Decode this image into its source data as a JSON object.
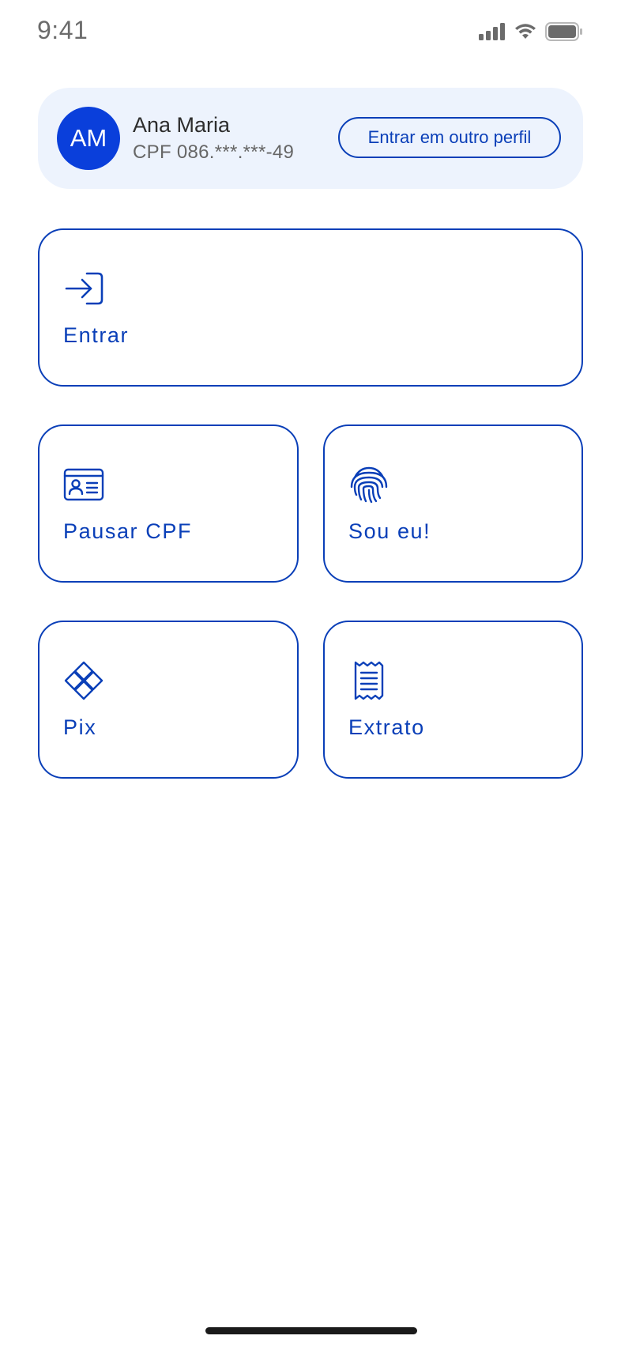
{
  "status_bar": {
    "time": "9:41",
    "icons": [
      "cellular-signal-icon",
      "wifi-icon",
      "battery-icon"
    ]
  },
  "profile": {
    "initials": "AM",
    "name": "Ana Maria",
    "cpf": "CPF 086.***.***-49",
    "switch_label": "Entrar em outro perfil"
  },
  "actions": {
    "entrar": {
      "label": "Entrar",
      "icon": "login-arrow-icon"
    },
    "pausar_cpf": {
      "label": "Pausar CPF",
      "icon": "id-card-icon"
    },
    "sou_eu": {
      "label": "Sou eu!",
      "icon": "fingerprint-icon"
    },
    "pix": {
      "label": "Pix",
      "icon": "pix-icon"
    },
    "extrato": {
      "label": "Extrato",
      "icon": "receipt-icon"
    }
  },
  "colors": {
    "accent": "#0a3fb8",
    "avatar_bg": "#0a3fdb",
    "profile_card_bg": "#edf3fd",
    "background": "#ffffff"
  }
}
